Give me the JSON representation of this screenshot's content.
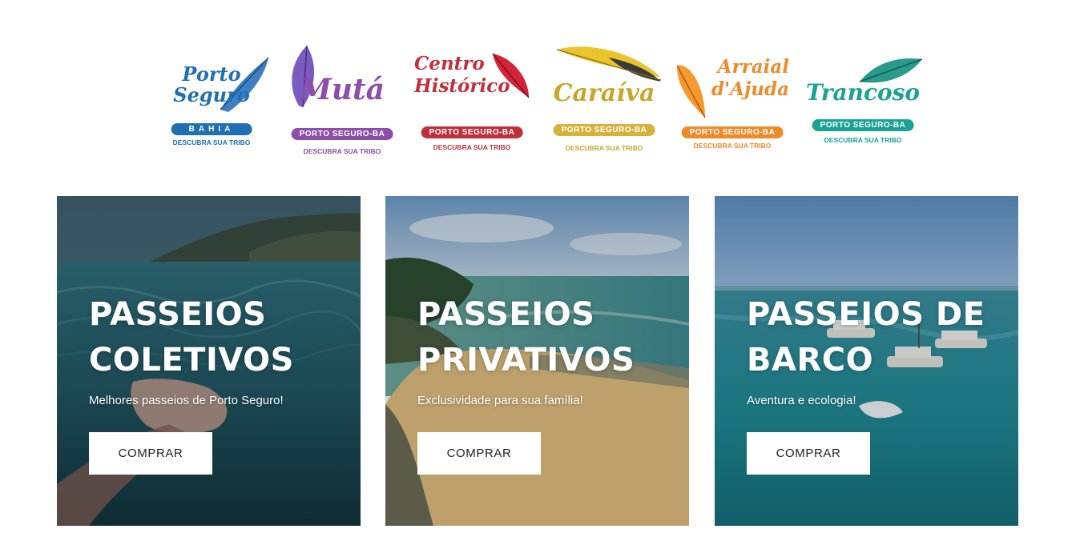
{
  "logos": [
    {
      "name_line1": "Porto",
      "name_line2": "Seguro",
      "badge": "BAHIA",
      "sub": "DESCUBRA SUA TRIBO",
      "color": "#1f6fb2",
      "feather": "#3d7fc1"
    },
    {
      "name_line1": "Mutá",
      "name_line2": "",
      "badge": "PORTO SEGURO-BA",
      "sub": "DESCUBRA SUA TRIBO",
      "color": "#8c4ea8",
      "feather": "#7a5cc0"
    },
    {
      "name_line1": "Centro",
      "name_line2": "Histórico",
      "badge": "PORTO SEGURO-BA",
      "sub": "DESCUBRA SUA TRIBO",
      "color": "#c0303c",
      "feather": "#d4243a"
    },
    {
      "name_line1": "Caraíva",
      "name_line2": "",
      "badge": "PORTO SEGURO-BA",
      "sub": "DESCUBRA SUA TRIBO",
      "color": "#c9a52a",
      "feather": "#e9c42b"
    },
    {
      "name_line1": "Arraial",
      "name_line2": "d'Ajuda",
      "badge": "PORTO SEGURO-BA",
      "sub": "DESCUBRA SUA TRIBO",
      "color": "#ee8a2a",
      "feather": "#f49a2e"
    },
    {
      "name_line1": "Trancoso",
      "name_line2": "",
      "badge": "PORTO SEGURO-BA",
      "sub": "DESCUBRA SUA TRIBO",
      "color": "#1aa394",
      "feather": "#2a9a8a"
    }
  ],
  "cards": [
    {
      "title_line1": "PASSEIOS",
      "title_line2": "COLETIVOS",
      "subtitle": "Melhores passeios de Porto Seguro!",
      "button": "COMPRAR"
    },
    {
      "title_line1": "PASSEIOS",
      "title_line2": "PRIVATIVOS",
      "subtitle": "Exclusividade para sua família!",
      "button": "COMPRAR"
    },
    {
      "title_line1": "PASSEIOS DE",
      "title_line2": "BARCO",
      "subtitle": "Aventura e ecologia!",
      "button": "COMPRAR"
    }
  ]
}
